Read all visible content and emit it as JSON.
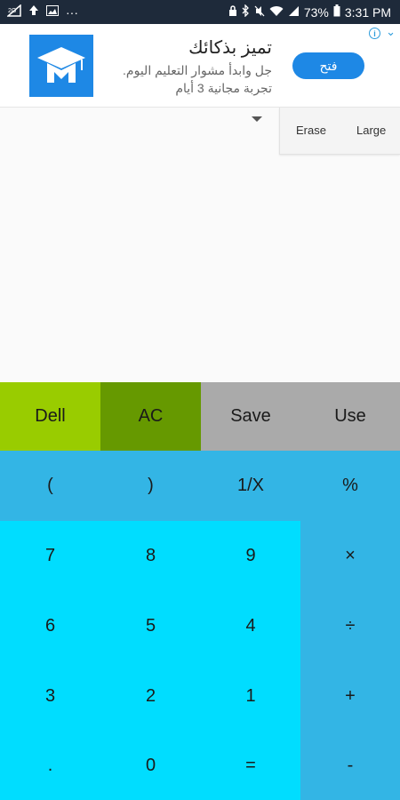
{
  "status_bar": {
    "left_icons": [
      "signal-icon",
      "upload-icon",
      "image-icon"
    ],
    "dots": "···",
    "battery_percent": "73%",
    "time": "3:31 PM"
  },
  "ad": {
    "title": "تميز بذكائك",
    "line1": "جل وابدأ مشوار التعليم اليوم.",
    "line2": "تجربة مجانية 3 أيام",
    "button": "فتح",
    "info": "i"
  },
  "display": {
    "modes": [
      "Erase",
      "Large"
    ]
  },
  "keypad": {
    "top_row": [
      "Dell",
      "AC",
      "Save",
      "Use"
    ],
    "paren_row": [
      "(",
      ")",
      "1/X",
      "%"
    ],
    "rows": [
      [
        "7",
        "8",
        "9",
        "×"
      ],
      [
        "6",
        "5",
        "4",
        "÷"
      ],
      [
        "3",
        "2",
        "1",
        "+"
      ],
      [
        ".",
        "0",
        "=",
        "-"
      ]
    ]
  },
  "colors": {
    "status_bar": "#1e2a3a",
    "dell": "#99cc00",
    "ac": "#669900",
    "save_use": "#aaaaaa",
    "operator_blue": "#33b5e5",
    "number_cyan": "#00ddff",
    "ad_blue": "#1e88e5"
  }
}
